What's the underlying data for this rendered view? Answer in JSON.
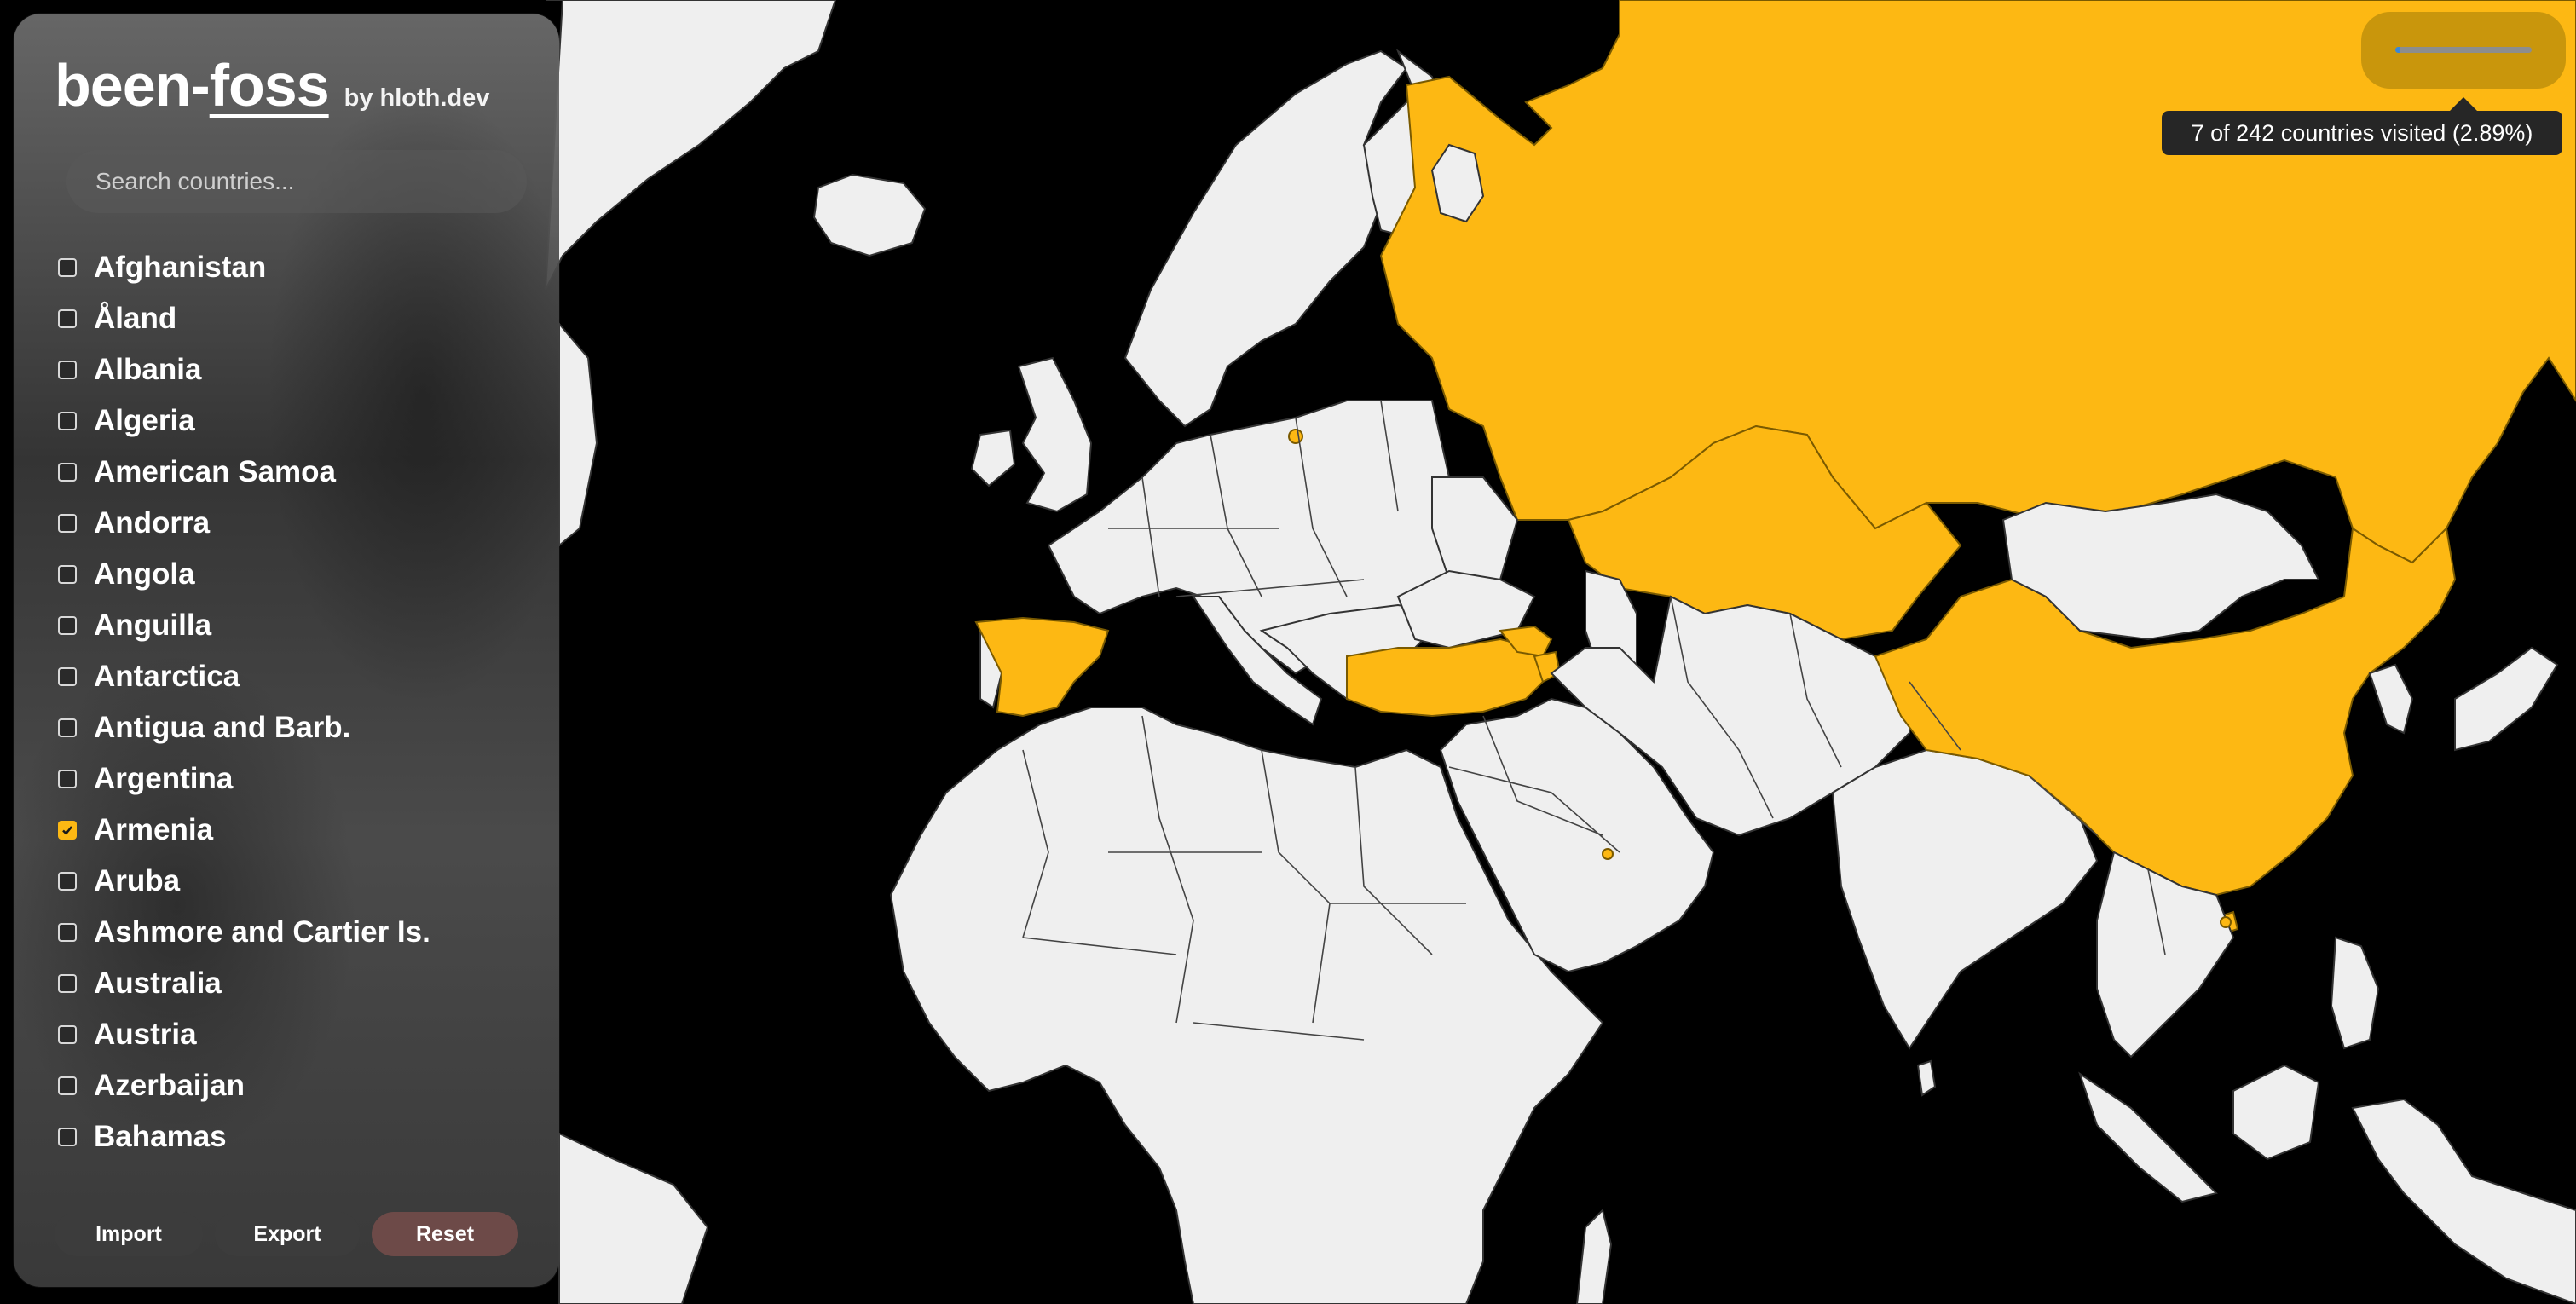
{
  "app": {
    "name_prefix": "been-",
    "name_underlined": "foss",
    "by_line": "by hloth.dev"
  },
  "search": {
    "placeholder": "Search countries..."
  },
  "countries": [
    {
      "label": "Afghanistan",
      "checked": false
    },
    {
      "label": "Åland",
      "checked": false
    },
    {
      "label": "Albania",
      "checked": false
    },
    {
      "label": "Algeria",
      "checked": false
    },
    {
      "label": "American Samoa",
      "checked": false
    },
    {
      "label": "Andorra",
      "checked": false
    },
    {
      "label": "Angola",
      "checked": false
    },
    {
      "label": "Anguilla",
      "checked": false
    },
    {
      "label": "Antarctica",
      "checked": false
    },
    {
      "label": "Antigua and Barb.",
      "checked": false
    },
    {
      "label": "Argentina",
      "checked": false
    },
    {
      "label": "Armenia",
      "checked": true
    },
    {
      "label": "Aruba",
      "checked": false
    },
    {
      "label": "Ashmore and Cartier Is.",
      "checked": false
    },
    {
      "label": "Australia",
      "checked": false
    },
    {
      "label": "Austria",
      "checked": false
    },
    {
      "label": "Azerbaijan",
      "checked": false
    },
    {
      "label": "Bahamas",
      "checked": false
    }
  ],
  "buttons": {
    "import": "Import",
    "export": "Export",
    "reset": "Reset"
  },
  "stats": {
    "tooltip": "7 of 242 countries visited (2.89%)",
    "progress_fraction": 0.0289
  },
  "colors": {
    "visited": "#fdb813",
    "land": "#efefef",
    "ocean": "#000000",
    "reset_button": "#6d4a48"
  }
}
